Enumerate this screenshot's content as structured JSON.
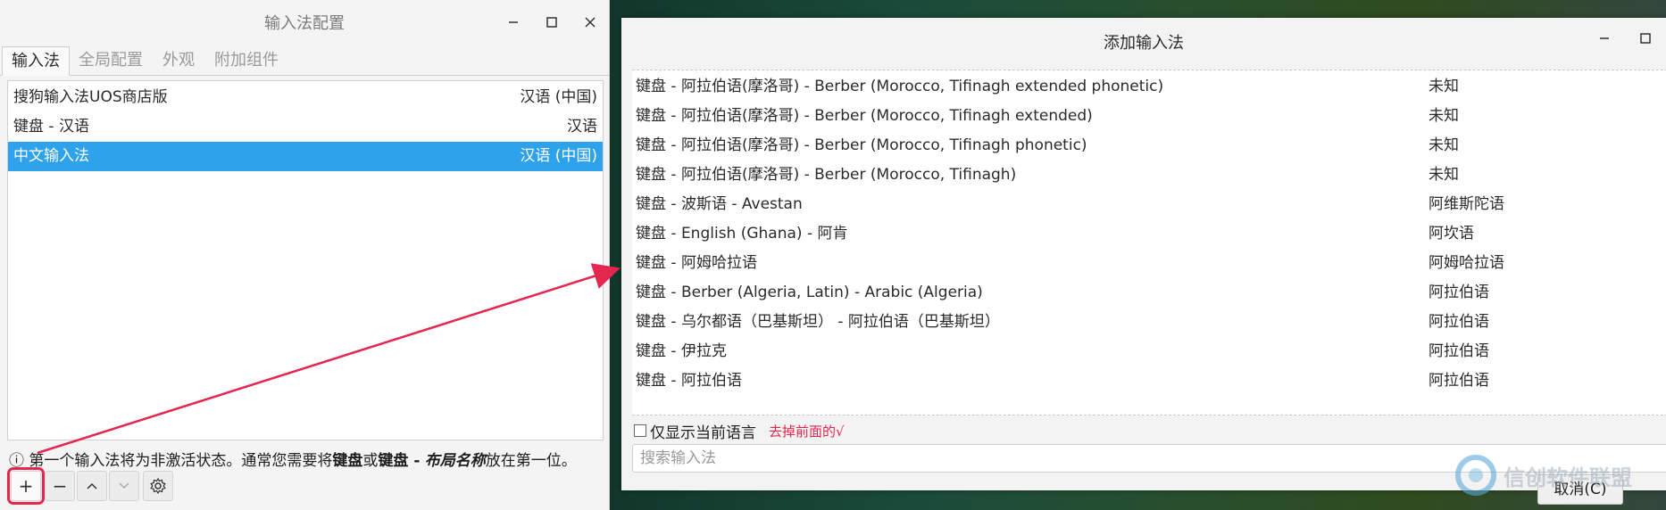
{
  "window1": {
    "title": "输入法配置",
    "tabs": [
      {
        "label": "输入法",
        "active": true
      },
      {
        "label": "全局配置"
      },
      {
        "label": "外观"
      },
      {
        "label": "附加组件"
      }
    ],
    "im_list": [
      {
        "name": "搜狗输入法UOS商店版",
        "lang": "汉语 (中国)",
        "selected": false
      },
      {
        "name": "键盘 - 汉语",
        "lang": "汉语",
        "selected": false
      },
      {
        "name": "中文输入法",
        "lang": "汉语 (中国)",
        "selected": true
      }
    ],
    "hint": {
      "icon": "ⓘ",
      "text_a": "第一个输入法将为非激活状态。通常您需要将",
      "bold1": "键盘",
      "text_b": "或",
      "bold2": "键盘 -",
      "italic": "布局名称",
      "text_c": "放在第一位。"
    },
    "toolbar": {
      "add": "+",
      "remove": "−",
      "up": "︿",
      "down": "﹀"
    }
  },
  "window2": {
    "title": "添加输入法",
    "rows": [
      {
        "name": "键盘 - 阿拉伯语(摩洛哥) - Berber (Morocco, Tifinagh extended phonetic)",
        "lang": "未知"
      },
      {
        "name": "键盘 - 阿拉伯语(摩洛哥) - Berber (Morocco, Tifinagh extended)",
        "lang": "未知"
      },
      {
        "name": "键盘 - 阿拉伯语(摩洛哥) - Berber (Morocco, Tifinagh phonetic)",
        "lang": "未知"
      },
      {
        "name": "键盘 - 阿拉伯语(摩洛哥) - Berber (Morocco, Tifinagh)",
        "lang": "未知"
      },
      {
        "name": "键盘 - 波斯语 - Avestan",
        "lang": "阿维斯陀语"
      },
      {
        "name": "键盘 - English (Ghana) - 阿肯",
        "lang": "阿坎语"
      },
      {
        "name": "键盘 - 阿姆哈拉语",
        "lang": "阿姆哈拉语"
      },
      {
        "name": "键盘 - Berber (Algeria, Latin) - Arabic (Algeria)",
        "lang": "阿拉伯语"
      },
      {
        "name": "键盘 - 乌尔都语（巴基斯坦） - 阿拉伯语（巴基斯坦）",
        "lang": "阿拉伯语"
      },
      {
        "name": "键盘 - 伊拉克",
        "lang": "阿拉伯语"
      },
      {
        "name": "键盘 - 阿拉伯语",
        "lang": "阿拉伯语"
      }
    ],
    "only_current_lang_label": "仅显示当前语言",
    "annotation": "去掉前面的√",
    "search_placeholder": "搜索输入法",
    "cancel_label": "取消(C)",
    "watermark": "信创软件联盟"
  },
  "colors": {
    "selection": "#2fa2ec",
    "annotation_red": "#e5264f"
  }
}
